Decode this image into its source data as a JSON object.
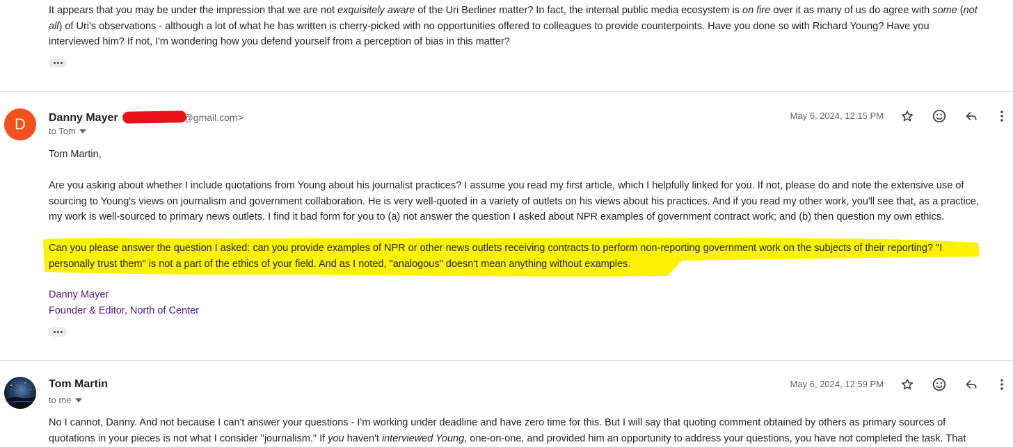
{
  "quoted_prev": {
    "line1_a": "It appears that you may be under the impression that we are not ",
    "line1_em1": "exquisitely aware",
    "line1_b": " of the Uri Berliner matter? In fact, the internal public media ecosystem is ",
    "line1_em2": "on fire",
    "line1_c": " over it as many of us do agree with ",
    "line1_em3": "some",
    "line1_d": " (",
    "line1_em4": "not",
    "line2_em": "all",
    "line2_rest": ") of Uri's observations - although a lot of what he has written is cherry-picked with no opportunities offered to colleagues to provide counterpoints. Have you done so with Richard Young? Have you",
    "line3": "interviewed him? If not, I'm wondering how you defend yourself from a perception of bias in this matter?"
  },
  "message1": {
    "avatar_letter": "D",
    "avatar_color": "#f4511e",
    "sender": "Danny Mayer",
    "email_suffix": "@gmail.com>",
    "to": "to Tom",
    "date": "May 6, 2024, 12:15 PM",
    "greeting": "Tom Martin,",
    "para1_l1": "Are you asking about whether I include quotations from Young about his journalist practices?  I assume you read my first article, which I helpfully linked for you. If not, please do and note the extensive use of",
    "para1_l2": "sourcing to Young's views on journalism and government collaboration.  He is very well-quoted in a variety of outlets on his views about his practices. And if you read my other work, you'll see that, as a practice,",
    "para1_l3": "my work is well-sourced to primary news outlets. I find it bad form for you to (a) not answer the question I asked about NPR examples of government contract work; and (b) then question my own ethics.",
    "para2_l1": "Can you please answer the question I asked: can you provide examples of NPR or other news outlets receiving contracts to perform non-reporting government work on the subjects of their reporting?  \"I",
    "para2_l2": "personally trust them\" is not a part of the ethics of your field.  And as I noted, \"analogous\" doesn't mean anything without examples.",
    "sig_name": "Danny Mayer",
    "sig_title": "Founder & Editor, North of Center",
    "highlight_color": "#fff200",
    "redaction_color": "#e8121b"
  },
  "message2": {
    "sender": "Tom Martin",
    "to": "to me",
    "date": "May 6, 2024, 12:59 PM",
    "l1": "No I cannot, Danny. And not because I can't answer your questions - I'm working under deadline and have zero time for this. But I will say that quoting comment obtained by others as primary sources of",
    "l2_a": "quotations in your pieces is not what I consider \"journalism.\" If ",
    "l2_em1": "you",
    "l2_b": " haven't ",
    "l2_em2": "interviewed Young",
    "l2_c": ", one-on-one, and provided him an opportunity to address your questions, you have not completed the task. That"
  },
  "icons": [
    "star-icon",
    "emoji-icon",
    "reply-icon",
    "more-vert-icon",
    "chevron-down-icon",
    "ellipsis-icon"
  ]
}
